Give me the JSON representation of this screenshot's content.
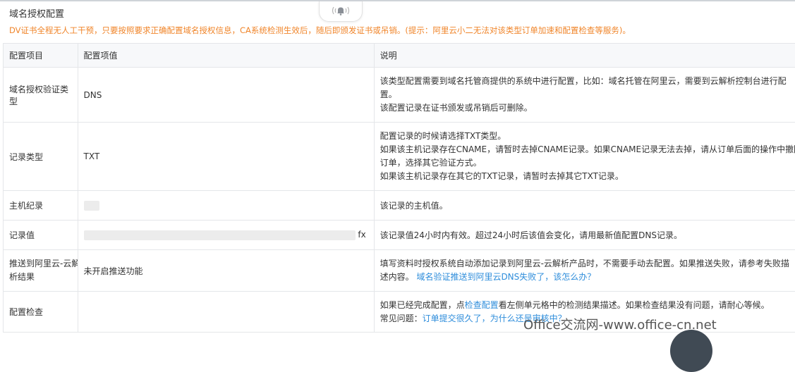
{
  "panel": {
    "title": "域名授权配置",
    "notice": "DV证书全程无人工干预，只要按照要求正确配置域名授权信息，CA系统检测生效后，随后即颁发证书或吊销。(提示：阿里云小二无法对该类型订单加速和配置检查等服务)。"
  },
  "table": {
    "headers": {
      "item": "配置项目",
      "value": "配置项值",
      "desc": "说明"
    },
    "rows": {
      "verify_type": {
        "item": "域名授权验证类型",
        "value": "DNS",
        "desc1": "该类型配置需要到域名托管商提供的系统中进行配置，比如：域名托管在阿里云，需要到云解析控制台进行配",
        "desc2": "置。",
        "desc3": "该配置记录在证书颁发或吊销后可删除。"
      },
      "record_type": {
        "item": "记录类型",
        "value": "TXT",
        "desc1": "配置记录的时候请选择TXT类型。",
        "desc2": "如果该主机记录存在CNAME，请暂时去掉CNAME记录。如果CNAME记录无法去掉，请从订单后面的操作中撤回",
        "desc3": "订单，选择其它验证方式。",
        "desc4": "如果该主机记录存在其它的TXT记录，请暂时去掉其它TXT记录。"
      },
      "host_record": {
        "item": "主机纪录",
        "desc": "该记录的主机值。"
      },
      "record_value": {
        "item": "记录值",
        "value_tail": "fx",
        "desc": "该记录值24小时内有效。超过24小时后该值会变化，请用最新值配置DNS记录。"
      },
      "push": {
        "item1": "推送到阿里云-云解",
        "item2": "析结果",
        "value": "未开启推送功能",
        "desc1": "填写资料时授权系统自动添加记录到阿里云-云解析产品时，不需要手动去配置。如果推送失败，请参考失败描",
        "desc2a": "述内容。",
        "desc2_link": "域名验证推送到阿里云DNS失败了，该怎么办？"
      },
      "check": {
        "item": "配置检查",
        "desc1a": "如果已经完成配置，点",
        "desc1_link": "检查配置",
        "desc1b": "看左侧单元格中的检测结果描述。如果检查结果没有问题，请耐心等候。",
        "desc2a": "常见问题：",
        "desc2_link": "订单提交很久了，为什么还是审核中？"
      }
    }
  },
  "watermark": "Office交流网-www.office-cn.net",
  "icons": {
    "bell": "bell-icon"
  },
  "colors": {
    "notice": "#f0852a",
    "link": "#2e8ddb",
    "header_bg": "#f7f8fa",
    "border": "#e4e6e9"
  }
}
